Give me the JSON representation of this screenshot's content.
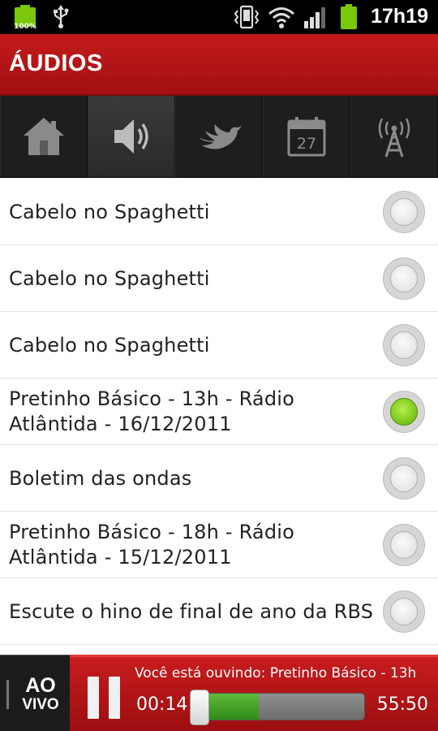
{
  "status_bar": {
    "battery_left_text": "100%",
    "time": "17h19",
    "icons": [
      "battery-icon",
      "usb-icon",
      "vibrate-icon",
      "wifi-icon",
      "signal-icon",
      "battery-icon"
    ]
  },
  "header": {
    "title": "ÁUDIOS"
  },
  "tabs": [
    {
      "name": "home",
      "icon": "home-icon",
      "active": false
    },
    {
      "name": "audios",
      "icon": "speaker-icon",
      "active": true
    },
    {
      "name": "twitter",
      "icon": "bird-icon",
      "active": false
    },
    {
      "name": "calendar",
      "icon": "calendar-icon",
      "calendar_day": "27",
      "active": false
    },
    {
      "name": "radio",
      "icon": "antenna-icon",
      "active": false
    }
  ],
  "audio_list": [
    {
      "title": "Cabelo no Spaghetti",
      "selected": false
    },
    {
      "title": "Cabelo no Spaghetti",
      "selected": false
    },
    {
      "title": "Cabelo no Spaghetti",
      "selected": false
    },
    {
      "title": "Pretinho Básico - 13h - Rádio Atlântida - 16/12/2011",
      "selected": true
    },
    {
      "title": "Boletim das ondas",
      "selected": false
    },
    {
      "title": "Pretinho Básico - 18h - Rádio Atlântida - 15/12/2011",
      "selected": false
    },
    {
      "title": "Escute o hino de final de ano da RBS",
      "selected": false
    }
  ],
  "player": {
    "live_line1": "AO",
    "live_line2": "VIVO",
    "now_playing": "Você está ouvindo: Pretinho Básico - 13h",
    "elapsed": "00:14",
    "total": "55:50",
    "buffered_fraction": 0.38,
    "played_fraction": 0.004
  },
  "colors": {
    "accent_red": "#b51517",
    "selected_green": "#7bd219",
    "progress_green": "#3f9a22"
  }
}
